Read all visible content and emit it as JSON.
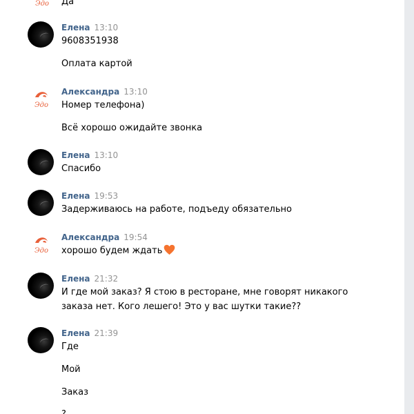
{
  "chat": {
    "top_partial_text": "Да",
    "messages": [
      {
        "author": "Елена",
        "time": "13:10",
        "lines": [
          "9608351938",
          "Оплата картой"
        ]
      },
      {
        "author": "Александра",
        "time": "13:10",
        "lines": [
          "Номер телефона)",
          "Всё хорошо ожидайте звонка"
        ]
      },
      {
        "author": "Елена",
        "time": "13:10",
        "lines": [
          "Спасибо"
        ]
      },
      {
        "author": "Елена",
        "time": "19:53",
        "lines": [
          "Задерживаюсь на работе, подъеду обязательно"
        ]
      },
      {
        "author": "Александра",
        "time": "19:54",
        "lines": [
          "хорошо будем ждать"
        ],
        "emoji": "orange-heart-icon"
      },
      {
        "author": "Елена",
        "time": "21:32",
        "lines": [
          "И где мой заказ? Я стою в ресторане, мне говорят никакого заказа нет. Кого лешего! Это у вас шутки такие??"
        ]
      },
      {
        "author": "Елена",
        "time": "21:39",
        "lines": [
          "Где",
          "Мой",
          "Заказ",
          "?"
        ]
      }
    ]
  },
  "colors": {
    "author": "#42648b",
    "time": "#939393",
    "heart": "#f5732f",
    "logo": "#e8603a"
  }
}
